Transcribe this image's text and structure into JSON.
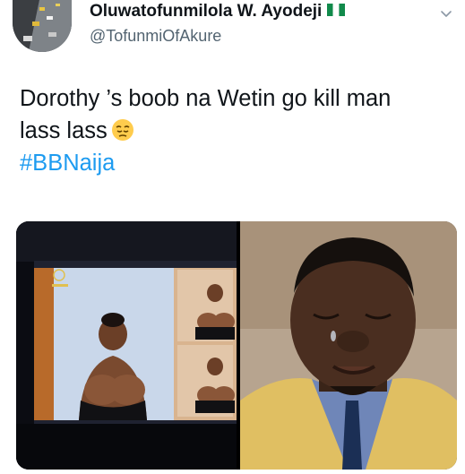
{
  "user": {
    "display_name": "Oluwatofunmilola W. Ayodeji",
    "handle": "@TofunmiOfAkure",
    "flag_icon": "nigeria-flag-icon"
  },
  "tweet": {
    "line1": "Dorothy ’s boob na Wetin go kill man",
    "line2": "lass lass",
    "emoji": "pensive-face",
    "hashtag": "#BBNaija"
  },
  "media": {
    "left_image": "tv-screen-photo",
    "right_image": "crying-man-photo"
  },
  "colors": {
    "hashtag": "#1d9bf0",
    "text": "#0f1419",
    "secondary": "#536471"
  }
}
